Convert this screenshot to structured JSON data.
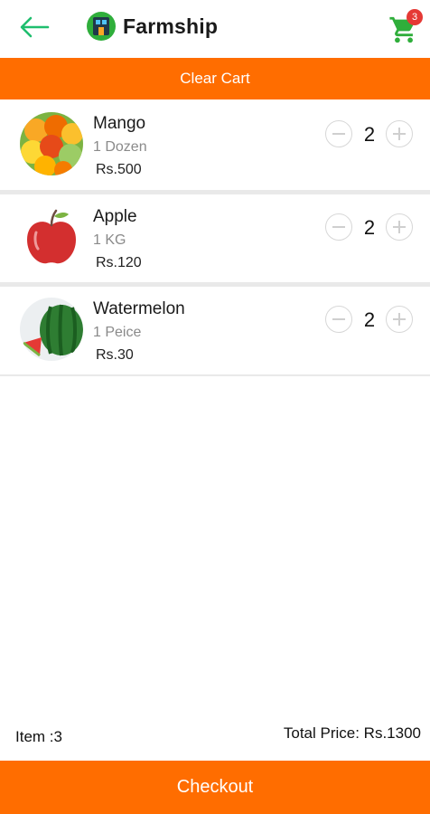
{
  "header": {
    "title": "Farmship",
    "back_icon": "arrow-left-icon",
    "cart_icon": "cart-icon",
    "cart_count": "3",
    "accent_color": "#1fbe6e",
    "logo_icon": "farmship-logo-icon"
  },
  "clear_cart": {
    "label": "Clear Cart",
    "color": "#ff6d00"
  },
  "cart_items": [
    {
      "name": "Mango",
      "unit": "1 Dozen",
      "price": "Rs.500",
      "qty": "2",
      "image": "mango-image"
    },
    {
      "name": "Apple",
      "unit": "1 KG",
      "price": "Rs.120",
      "qty": "2",
      "image": "apple-image"
    },
    {
      "name": "Watermelon",
      "unit": "1 Peice",
      "price": "Rs.30",
      "qty": "2",
      "image": "watermelon-image"
    }
  ],
  "summary": {
    "item_count": "Item :3",
    "total_price": "Total Price: Rs.1300"
  },
  "checkout": {
    "label": "Checkout",
    "color": "#ff6d00"
  }
}
